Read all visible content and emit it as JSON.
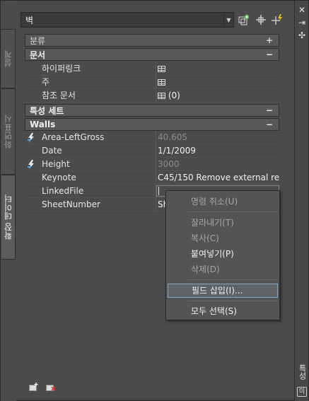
{
  "left_tabs": [
    {
      "label": "설계",
      "active": false
    },
    {
      "label": "화면표시",
      "active": false
    },
    {
      "label": "확장 데이터",
      "active": true
    }
  ],
  "right_strip": {
    "label": "특성",
    "close_glyph": "✕",
    "autohide_glyph": "⇥",
    "options_glyph": "✣",
    "mini_icon": "미"
  },
  "topbar": {
    "selection_value": "벽",
    "toolbar_icons": [
      "add-property-set-icon",
      "pick-objects-icon",
      "quick-select-icon"
    ]
  },
  "categories": {
    "classification": {
      "label": "분류",
      "toggle": "+"
    },
    "documents": {
      "label": "문서",
      "toggle": "−"
    },
    "property_sets": {
      "label": "특성 세트",
      "toggle": "−"
    },
    "walls": {
      "label": "Walls",
      "toggle": "−"
    }
  },
  "document_rows": [
    {
      "name": "하이퍼링크",
      "value": ""
    },
    {
      "name": "주",
      "value": ""
    },
    {
      "name": "참조 문서",
      "value": "(0)"
    }
  ],
  "wall_rows": [
    {
      "name": "Area-LeftGross",
      "value": "40.605",
      "dim": true,
      "icon": "lightning-icon"
    },
    {
      "name": "Date",
      "value": "1/1/2009",
      "dim": false
    },
    {
      "name": "Height",
      "value": "3000",
      "dim": true,
      "icon": "lightning-icon"
    },
    {
      "name": "Keynote",
      "value": "C45/150  Remove external re...",
      "dim": false
    },
    {
      "name": "LinkedFile",
      "value": "",
      "dim": false
    },
    {
      "name": "SheetNumber",
      "value": "Sh",
      "dim": false
    }
  ],
  "context_menu": {
    "items": [
      {
        "label": "명령 취소(U)",
        "enabled": false
      },
      {
        "label": "잘라내기(T)",
        "enabled": false
      },
      {
        "label": "복사(C)",
        "enabled": false
      },
      {
        "label": "붙여넣기(P)",
        "enabled": true
      },
      {
        "label": "삭제(D)",
        "enabled": false
      },
      {
        "label": "필드 삽입(I)...",
        "enabled": true,
        "highlighted": true
      },
      {
        "label": "모두 선택(S)",
        "enabled": true
      }
    ]
  },
  "colors": {
    "panel": "#4b4b4b",
    "category": "#585858",
    "highlight_border": "#8aa6c4"
  }
}
